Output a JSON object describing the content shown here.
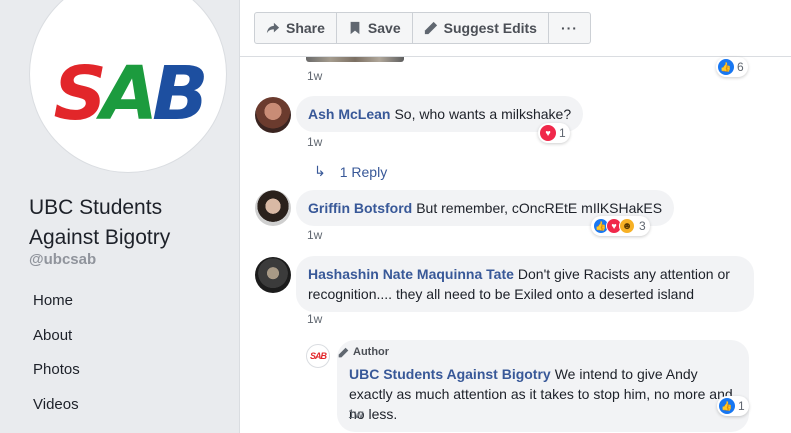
{
  "page": {
    "name": "UBC Students Against Bigotry",
    "handle": "@ubcsab",
    "logo": {
      "s": "S",
      "a": "A",
      "b": "B"
    }
  },
  "nav": [
    "Home",
    "About",
    "Photos",
    "Videos"
  ],
  "toolbar": {
    "share": "Share",
    "save": "Save",
    "suggest": "Suggest Edits",
    "more": "···"
  },
  "top_comment": {
    "time": "1w",
    "reaction_count": "6"
  },
  "comments": [
    {
      "author": "Ash McLean",
      "text": "So, who wants a milkshake?",
      "time": "1w",
      "reaction_count": "1",
      "reply_link": "1 Reply"
    },
    {
      "author": "Griffin Botsford",
      "text": "But remember, cOncREtE mIlKSHakES",
      "time": "1w",
      "reaction_count": "3"
    },
    {
      "author": "Hashashin Nate Maquinna Tate",
      "text": "Don't give Racists any attention or recognition.... they all need to be Exiled onto a deserted island",
      "time": "1w"
    }
  ],
  "reply": {
    "tag": "Author",
    "author": "UBC Students Against Bigotry",
    "text": "We intend to give Andy exactly as much attention as it takes to stop him, no more and no less.",
    "time": "1w",
    "reaction_count": "1",
    "avatar_text": "SAB"
  },
  "colors": {
    "link": "#385898",
    "like": "#1877f2",
    "love": "#f0284a",
    "haha": "#f7b125"
  }
}
